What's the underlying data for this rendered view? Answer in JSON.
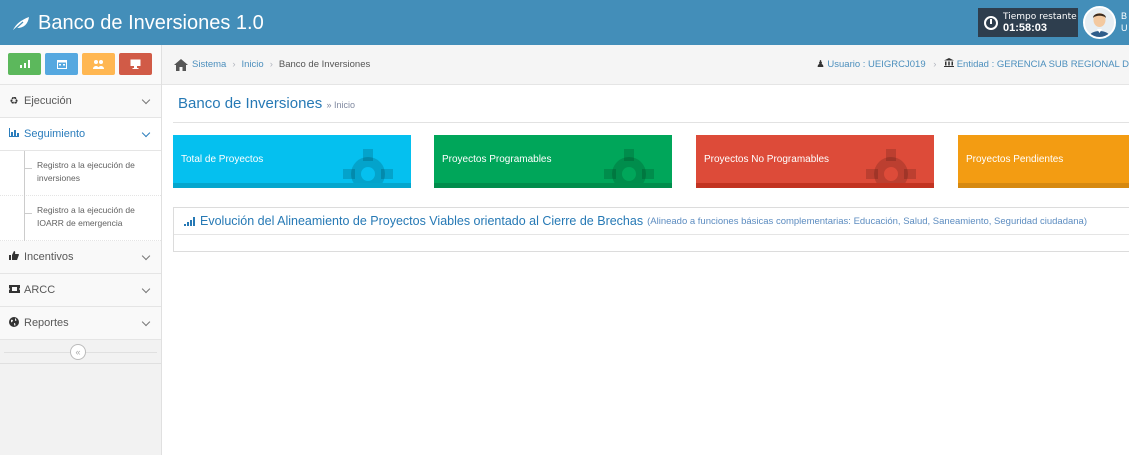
{
  "app": {
    "title": "Banco de Inversiones 1.0",
    "timer": {
      "label": "Tiempo restante",
      "value": "01:58:03"
    },
    "user_cut": "B U"
  },
  "colors": {
    "navbar": "#438eb9",
    "shortcut_green": "#5cb85c",
    "shortcut_blue": "#55a8e0",
    "shortcut_orange": "#ffb752",
    "shortcut_red": "#d15b47",
    "box_blue": "#05c0ef",
    "box_green": "#00a65a",
    "box_red": "#dd4b39",
    "box_orange": "#f39c12"
  },
  "sidebar": {
    "shortcuts": [
      {
        "icon": "signal-icon"
      },
      {
        "icon": "calendar-icon"
      },
      {
        "icon": "users-icon"
      },
      {
        "icon": "desktop-icon"
      }
    ],
    "ejecucion": "Ejecución",
    "seguimiento": "Seguimiento",
    "sub1": "Registro a la ejecución de inversiones",
    "sub2": "Registro a la ejecución de IOARR de emergencia",
    "incentivos": "Incentivos",
    "arcc": "ARCC",
    "reportes": "Reportes",
    "collapse": "«"
  },
  "breadcrumb": {
    "sistema": "Sistema",
    "inicio": "Inicio",
    "current": "Banco de Inversiones",
    "sep": "›",
    "usuario": "Usuario : UEIGRCJ019",
    "entidad": "Entidad : GERENCIA SUB REGIONAL D"
  },
  "page": {
    "title": "Banco de Inversiones",
    "subtitle": "» Inicio"
  },
  "boxes": {
    "total": "Total de Proyectos",
    "programables": "Proyectos Programables",
    "no_programables": "Proyectos No Programables",
    "pendientes": "Proyectos Pendientes"
  },
  "panel": {
    "title": "Evolución del Alineamiento de Proyectos Viables orientado al Cierre de Brechas",
    "subtitle": "(Alineado a funciones básicas complementarias: Educación, Salud, Saneamiento, Seguridad ciudadana)"
  }
}
